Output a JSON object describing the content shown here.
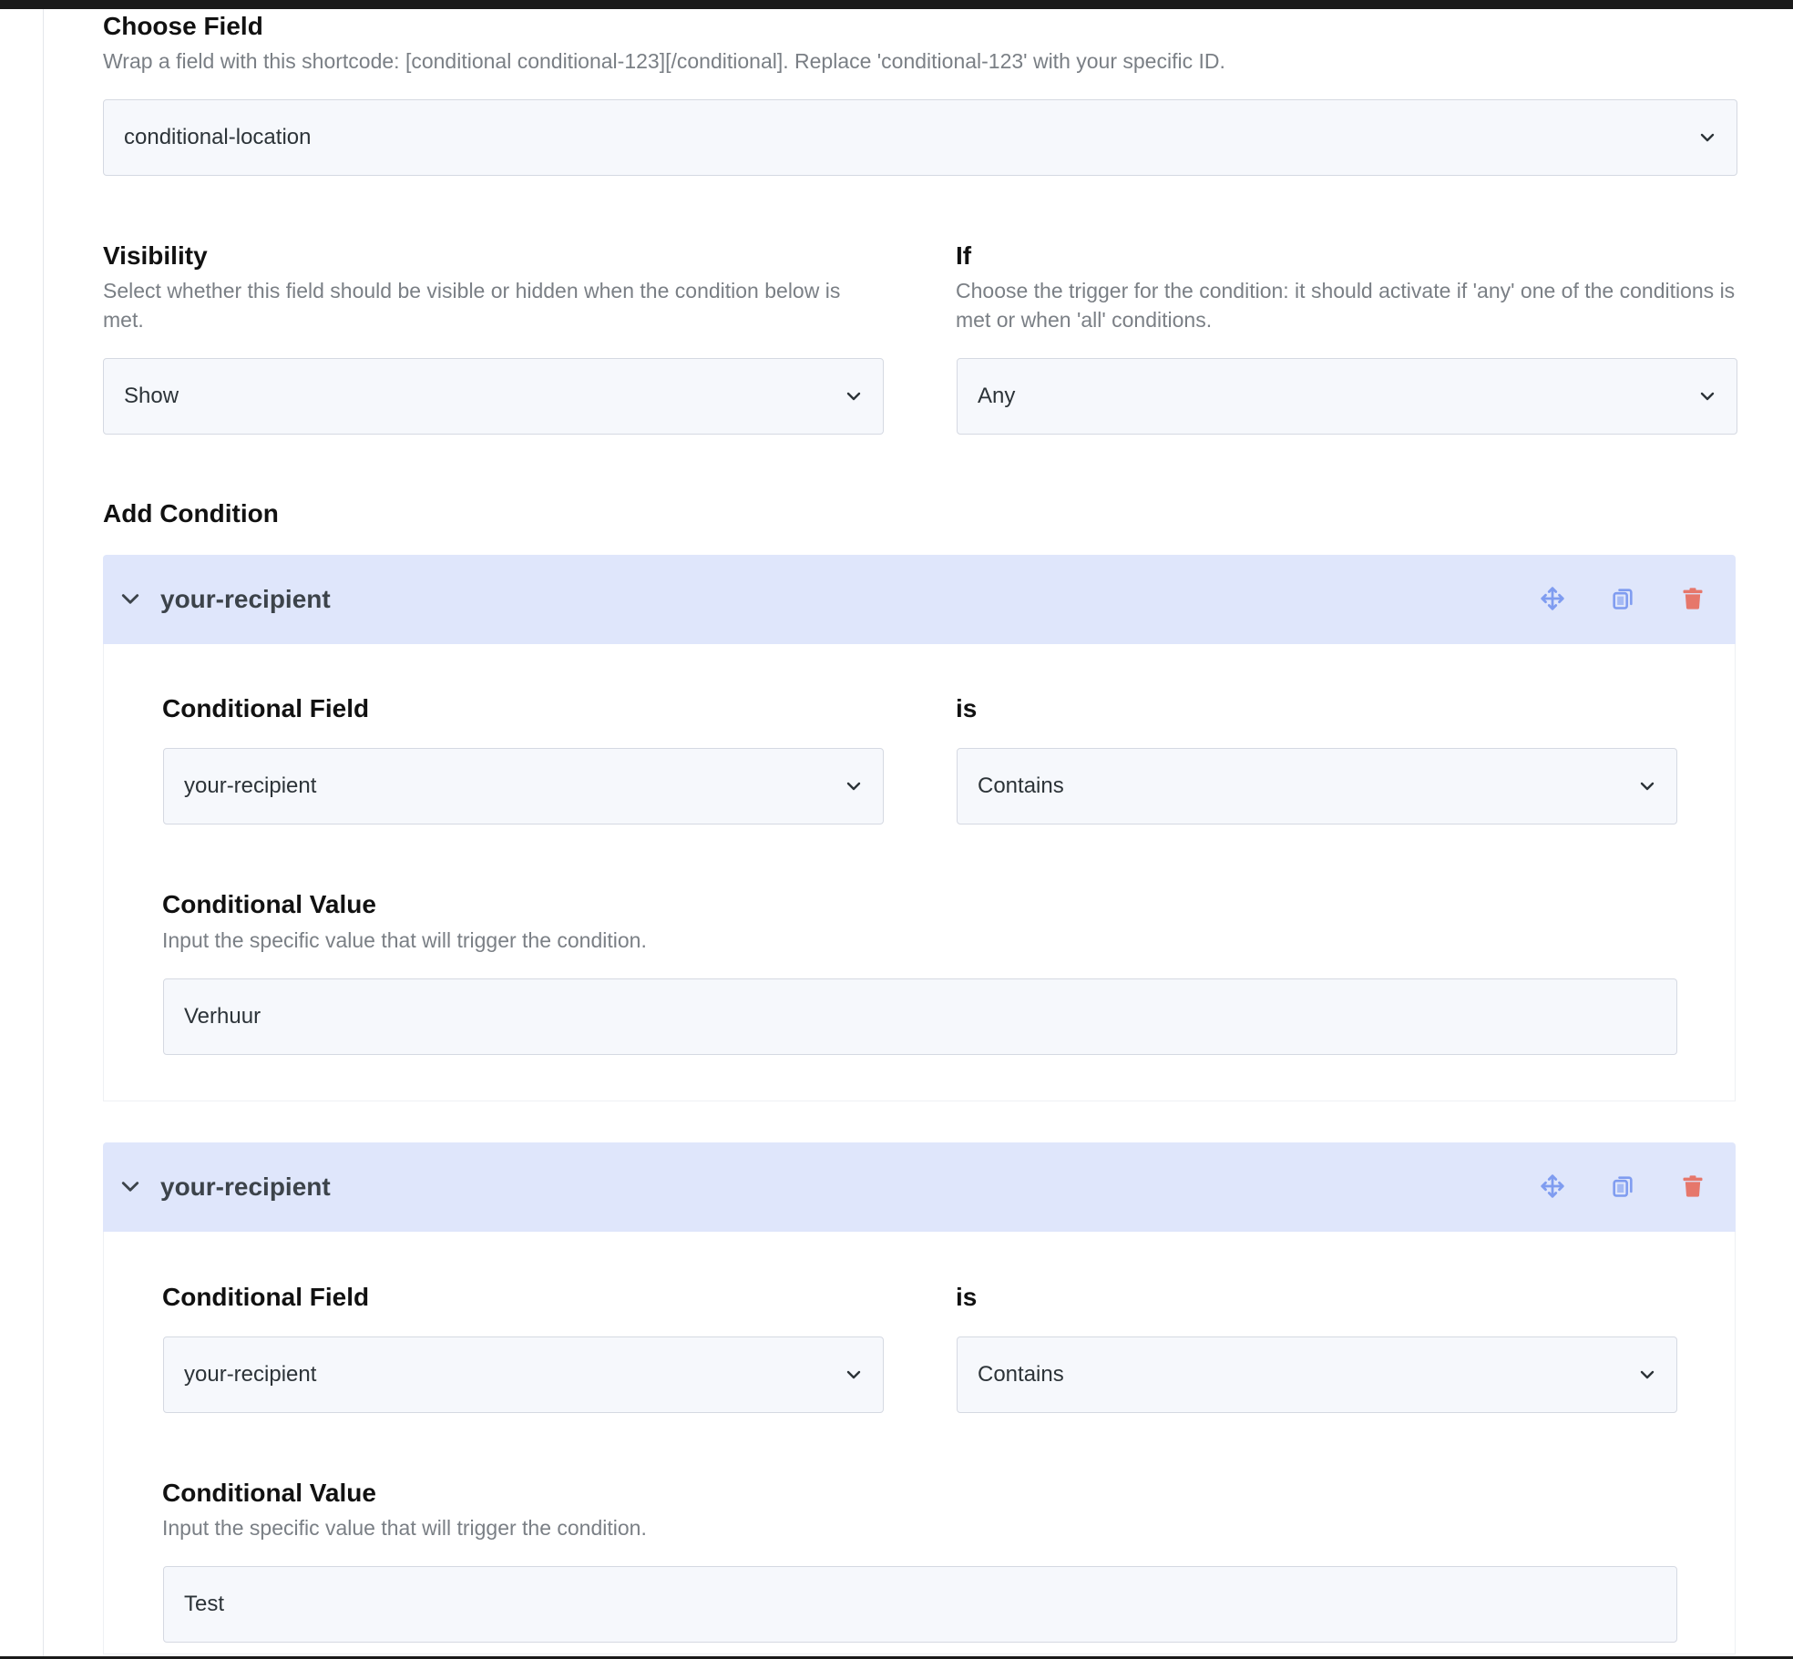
{
  "choose_field": {
    "label": "Choose Field",
    "description": "Wrap a field with this shortcode: [conditional conditional-123][/conditional]. Replace 'conditional-123' with your specific ID.",
    "value": "conditional-location"
  },
  "visibility": {
    "label": "Visibility",
    "description": "Select whether this field should be visible or hidden when the condition below is met.",
    "value": "Show"
  },
  "if": {
    "label": "If",
    "description": "Choose the trigger for the condition: it should activate if 'any' one of the conditions is met or when 'all' conditions.",
    "value": "Any"
  },
  "add_condition": {
    "label": "Add Condition"
  },
  "conditions": [
    {
      "title": "your-recipient",
      "field_label": "Conditional Field",
      "field_value": "your-recipient",
      "operator_label": "is",
      "operator_value": "Contains",
      "value_label": "Conditional Value",
      "value_description": "Input the specific value that will trigger the condition.",
      "value": "Verhuur"
    },
    {
      "title": "your-recipient",
      "field_label": "Conditional Field",
      "field_value": "your-recipient",
      "operator_label": "is",
      "operator_value": "Contains",
      "value_label": "Conditional Value",
      "value_description": "Input the specific value that will trigger the condition.",
      "value": "Test"
    }
  ],
  "colors": {
    "panel_header_bg": "#dfe6fb",
    "action_icon": "#7f9cf0",
    "delete_icon": "#e6776b",
    "field_bg": "#f6f8fc"
  },
  "icons": {
    "collapse": "chevron-down-icon",
    "move": "move-arrows-icon",
    "duplicate": "copy-icon",
    "delete": "trash-icon",
    "select": "chevron-down-icon"
  }
}
